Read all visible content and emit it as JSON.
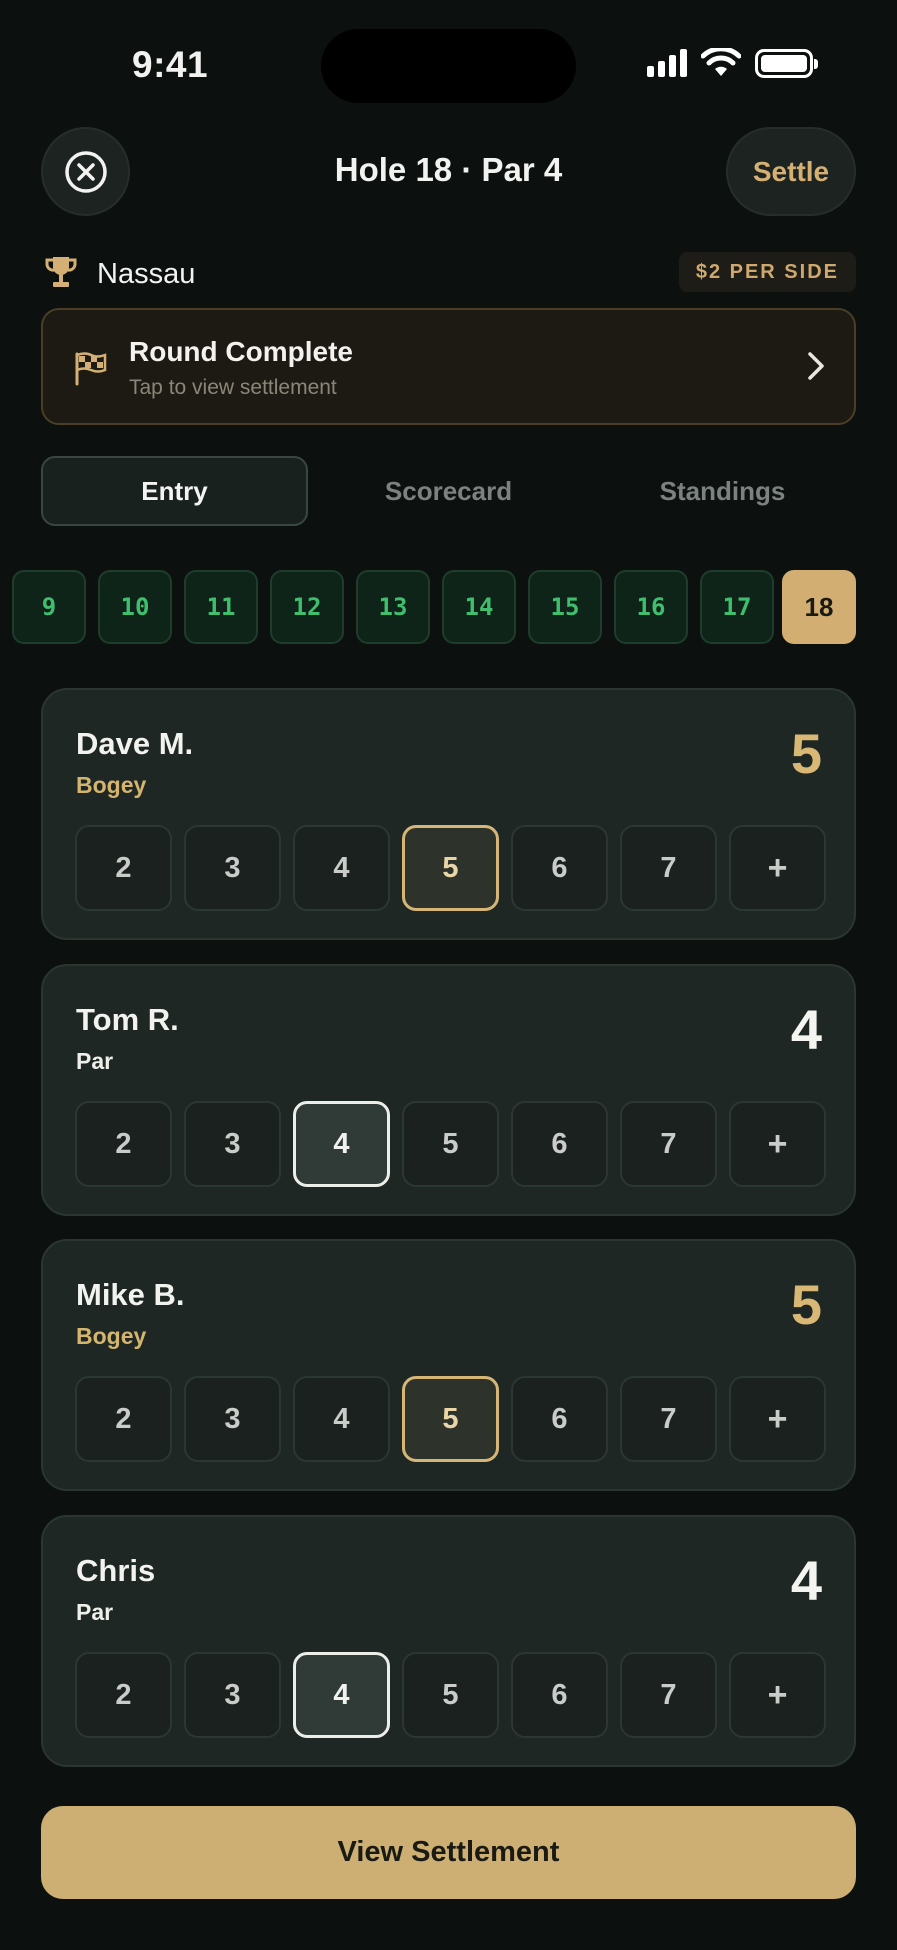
{
  "status_bar": {
    "time": "9:41"
  },
  "header": {
    "title": "Hole 18 · Par 4",
    "settle_label": "Settle"
  },
  "game": {
    "name": "Nassau",
    "stake": "$2 PER SIDE"
  },
  "banner": {
    "title": "Round Complete",
    "subtitle": "Tap to view settlement"
  },
  "tabs": [
    {
      "label": "Entry",
      "active": true
    },
    {
      "label": "Scorecard",
      "active": false
    },
    {
      "label": "Standings",
      "active": false
    }
  ],
  "holes": [
    "9",
    "10",
    "11",
    "12",
    "13",
    "14",
    "15",
    "16",
    "17",
    "18"
  ],
  "current_hole": "18",
  "score_options": [
    "2",
    "3",
    "4",
    "5",
    "6",
    "7",
    "+"
  ],
  "players": [
    {
      "name": "Dave M.",
      "status": "Bogey",
      "score": "5"
    },
    {
      "name": "Tom R.",
      "status": "Par",
      "score": "4"
    },
    {
      "name": "Mike B.",
      "status": "Bogey",
      "score": "5"
    },
    {
      "name": "Chris",
      "status": "Par",
      "score": "4"
    }
  ],
  "cta_label": "View Settlement",
  "colors": {
    "background": "#0c100f",
    "card": "#1e2723",
    "gold": "#cdae73",
    "hole_green": "#3fbf6e"
  }
}
